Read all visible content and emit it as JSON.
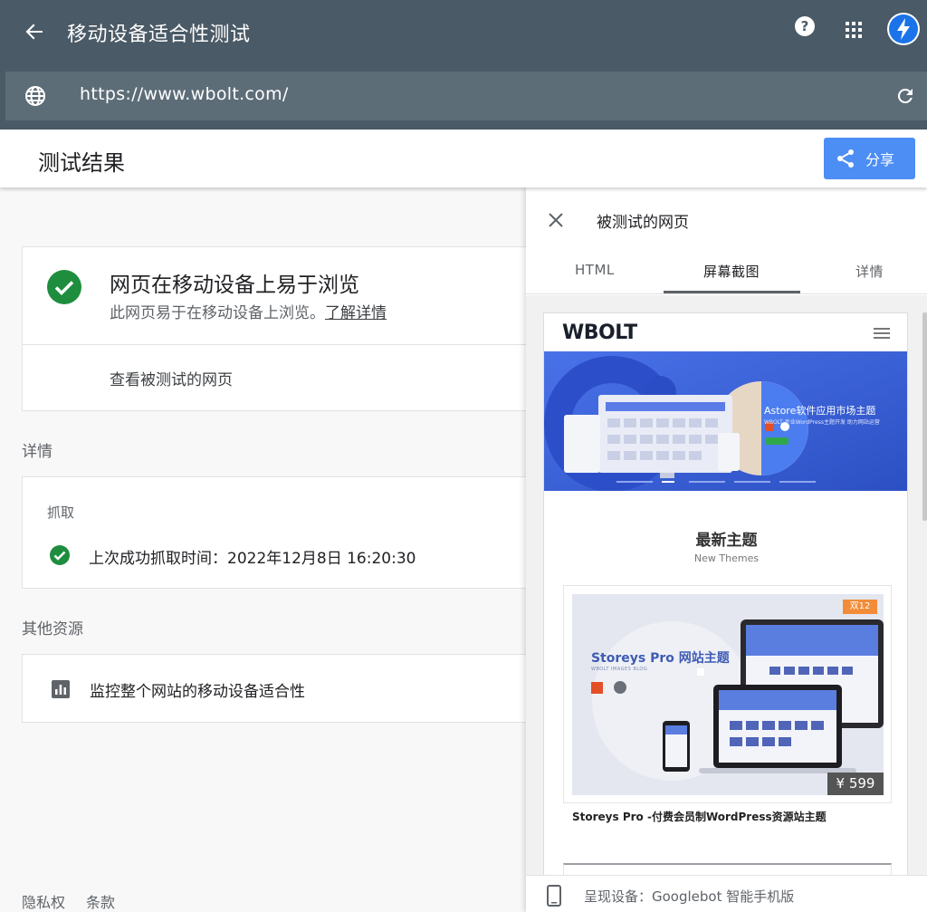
{
  "app": {
    "title": "移动设备适合性测试",
    "url": "https://www.wbolt.com/"
  },
  "header": {
    "title": "测试结果",
    "share_label": "分享"
  },
  "result": {
    "title": "网页在移动设备上易于浏览",
    "subtitle": "此网页易于在移动设备上浏览。",
    "learn_more": "了解详情",
    "view_tested_page": "查看被测试的网页"
  },
  "details": {
    "label": "详情",
    "crawl_label": "抓取",
    "crawl_time": "上次成功抓取时间：2022年12月8日 16:20:30"
  },
  "resources": {
    "label": "其他资源",
    "monitor": "监控整个网站的移动设备适合性"
  },
  "footer": {
    "privacy": "隐私权",
    "terms": "条款"
  },
  "panel": {
    "title": "被测试的网页",
    "tabs": [
      "HTML",
      "屏幕截图",
      "详情"
    ],
    "active_tab": "屏幕截图",
    "device": "呈现设备：Googlebot 智能手机版"
  },
  "preview": {
    "logo": "WBOLT",
    "hero_title": "Astore软件应用市场主题",
    "hero_sub": "WBOLT 专业WordPress主题开发 助力网站运营",
    "section_title": "最新主题",
    "section_sub": "New Themes",
    "product_badge": "双12",
    "product_image_title": "Storeys Pro 网站主题",
    "product_image_sub": "WBOLT IMAGES BLOG",
    "product_price": "¥ 599",
    "product_name": "Storeys Pro -付费会员制WordPress资源站主题"
  },
  "colors": {
    "appbar": "#4a5a66",
    "urlbar": "#5d6d78",
    "accent": "#4d8ef5",
    "success": "#1e8e3e",
    "hero": "#3a62d8"
  }
}
